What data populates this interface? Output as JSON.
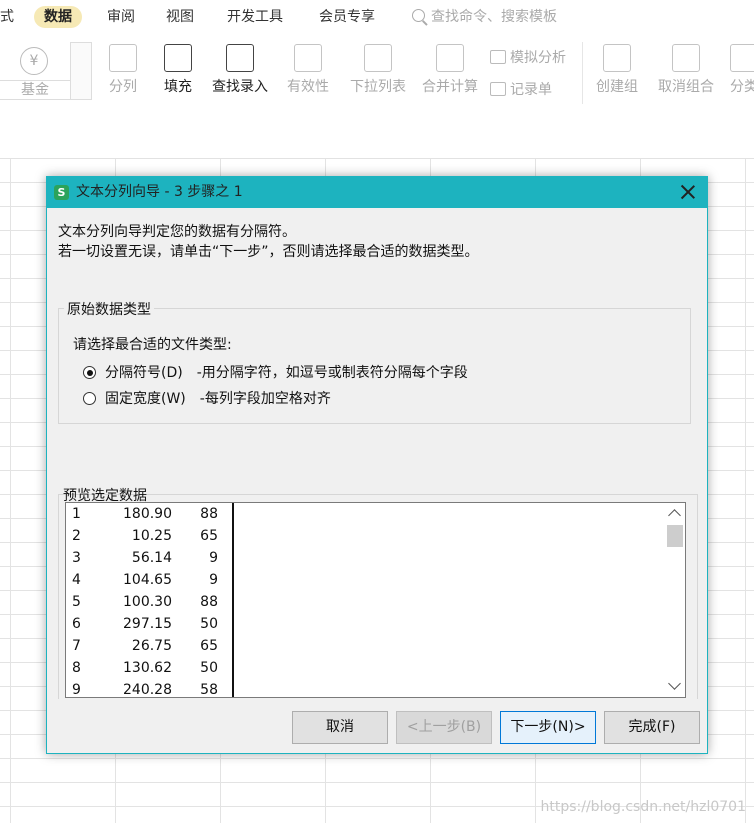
{
  "menubar": {
    "items": [
      "式",
      "数据",
      "审阅",
      "视图",
      "开发工具",
      "会员专享"
    ],
    "active": "数据",
    "search_placeholder": "查找命令、搜索模板"
  },
  "ribbon": {
    "fund_label": "基金",
    "fund_symbol": "¥",
    "buttons": {
      "split": "分列",
      "fill": "填充",
      "find_entry": "查找录入",
      "validity": "有效性",
      "dropdown": "下拉列表",
      "merge_calc": "合并计算",
      "simulate": "模拟分析",
      "record": "记录单",
      "create_group": "创建组",
      "ungroup": "取消组合",
      "subtotal": "分类"
    }
  },
  "dialog": {
    "title": "文本分列向导 - 3 步骤之 1",
    "icon_letter": "S",
    "description_line1": "文本分列向导判定您的数据有分隔符。",
    "description_line2": "若一切设置无误，请单击“下一步”，否则请选择最合适的数据类型。",
    "group_title": "原始数据类型",
    "prompt": "请选择最合适的文件类型:",
    "options": [
      {
        "label": "分隔符号(D)",
        "description": "-用分隔字符，如逗号或制表符分隔每个字段",
        "selected": true
      },
      {
        "label": "固定宽度(W)",
        "description": "-每列字段加空格对齐",
        "selected": false
      }
    ],
    "preview_label": "预览选定数据",
    "preview_rows": [
      {
        "n": "1",
        "a": "180.90",
        "b": "88"
      },
      {
        "n": "2",
        "a": "10.25",
        "b": "65"
      },
      {
        "n": "3",
        "a": "56.14",
        "b": "9"
      },
      {
        "n": "4",
        "a": "104.65",
        "b": "9"
      },
      {
        "n": "5",
        "a": "100.30",
        "b": "88"
      },
      {
        "n": "6",
        "a": "297.15",
        "b": "50"
      },
      {
        "n": "7",
        "a": "26.75",
        "b": "65"
      },
      {
        "n": "8",
        "a": "130.62",
        "b": "50"
      },
      {
        "n": "9",
        "a": "240.28",
        "b": "58"
      }
    ],
    "buttons": {
      "cancel": "取消",
      "back": "<上一步(B)",
      "next": "下一步(N)>",
      "finish": "完成(F)"
    }
  },
  "watermark": "https://blog.csdn.net/hzl0701",
  "colors": {
    "titlebar": "#1db3bf",
    "active_menu_bg": "#f6e9b5",
    "app_icon": "#2ba35b",
    "default_button_border": "#0078d7"
  }
}
